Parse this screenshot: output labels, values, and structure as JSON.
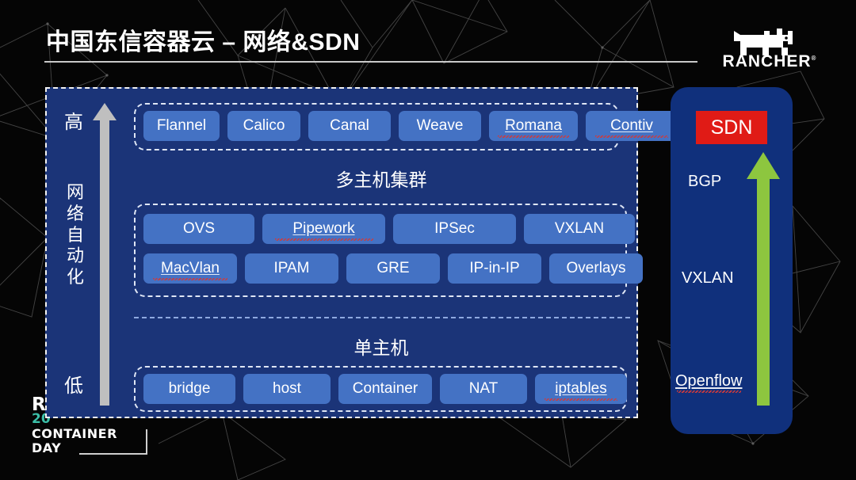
{
  "header": {
    "title": "中国东信容器云 – 网络&SDN"
  },
  "brand": {
    "logo_icon": "rancher-cow-icon",
    "wordmark": "RANCHER",
    "registered_mark": "®"
  },
  "event_logo": {
    "line1": "R",
    "line2": "20",
    "line3": "CONTAINER",
    "line4": "DAY"
  },
  "main_panel": {
    "axis": {
      "top_label": "高",
      "bottom_label": "低",
      "vertical_label": "网络自动化",
      "arrow_icon": "gray-up-arrow-icon",
      "arrow_color": "#bfbfbf"
    },
    "multi_host": {
      "title": "多主机集群",
      "top_row": [
        {
          "label": "Flannel",
          "misspelled": false,
          "width": 96
        },
        {
          "label": "Calico",
          "misspelled": false,
          "width": 92
        },
        {
          "label": "Canal",
          "misspelled": false,
          "width": 104
        },
        {
          "label": "Weave",
          "misspelled": false,
          "width": 104
        },
        {
          "label": "Romana",
          "misspelled": true,
          "width": 112
        },
        {
          "label": "Contiv",
          "misspelled": true,
          "width": 116
        }
      ],
      "row_two": [
        {
          "label": "OVS",
          "misspelled": false,
          "width": 140
        },
        {
          "label": "Pipework",
          "misspelled": true,
          "width": 155
        },
        {
          "label": "IPSec",
          "misspelled": false,
          "width": 155
        },
        {
          "label": "VXLAN",
          "misspelled": false,
          "width": 140
        }
      ],
      "row_three": [
        {
          "label": "MacVlan",
          "misspelled": true,
          "width": 118
        },
        {
          "label": "IPAM",
          "misspelled": false,
          "width": 118
        },
        {
          "label": "GRE",
          "misspelled": false,
          "width": 118
        },
        {
          "label": "IP-in-IP",
          "misspelled": false,
          "width": 118
        },
        {
          "label": "Overlays",
          "misspelled": false,
          "width": 118
        }
      ]
    },
    "single_host": {
      "title": "单主机",
      "row": [
        {
          "label": "bridge",
          "misspelled": false,
          "width": 116
        },
        {
          "label": "host",
          "misspelled": false,
          "width": 110
        },
        {
          "label": "Container",
          "misspelled": false,
          "width": 118
        },
        {
          "label": "NAT",
          "misspelled": false,
          "width": 110
        },
        {
          "label": "iptables",
          "misspelled": true,
          "width": 116
        }
      ]
    }
  },
  "sdn_panel": {
    "badge": "SDN",
    "badge_color": "#e01b16",
    "arrow_icon": "green-up-arrow-icon",
    "arrow_color": "#8dc63f",
    "labels": {
      "top": "BGP",
      "middle": "VXLAN",
      "bottom": "Openflow"
    }
  },
  "theme": {
    "background": "#050505",
    "panel_blue": "#1b3478",
    "sdn_blue": "#10307c",
    "chip_blue": "#4472c4",
    "accent_red": "#e01b16",
    "accent_green": "#8dc63f"
  }
}
